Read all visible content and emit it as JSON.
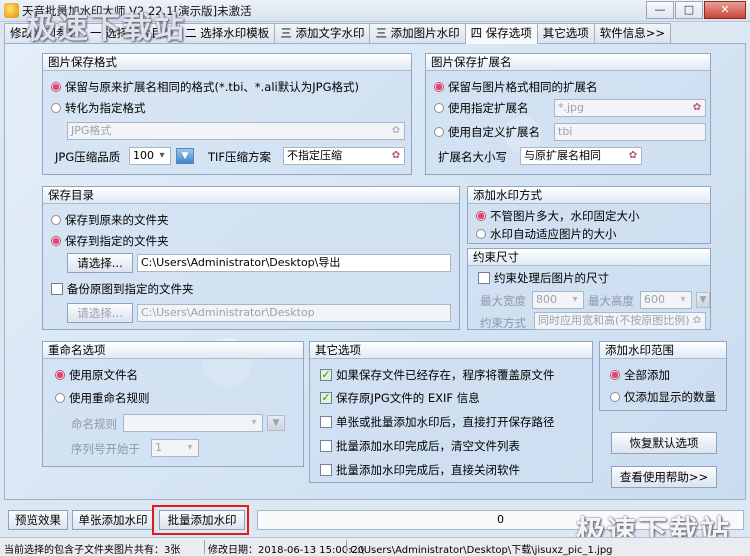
{
  "window": {
    "title": "天音批量加水印大师 V2.22.1[演示版]未激活",
    "controls": {
      "minimize": "—",
      "maximize": "□",
      "close": "✕"
    }
  },
  "watermark_text": "极速下载站",
  "tabs": [
    {
      "label": "修改水印参数"
    },
    {
      "label": "一 选择图片目录"
    },
    {
      "label": "二 选择水印模板"
    },
    {
      "label": "三 添加文字水印"
    },
    {
      "label": "三 添加图片水印"
    },
    {
      "label": "四 保存选项"
    },
    {
      "label": "其它选项"
    },
    {
      "label": "软件信息>>"
    }
  ],
  "image_format": {
    "title": "图片保存格式",
    "keep_original": "保留与原来扩展名相同的格式(*.tbi、*.ali默认为JPG格式)",
    "convert": "转化为指定格式",
    "format_value": "JPG格式",
    "jpg_quality_label": "JPG压缩品质",
    "jpg_quality_value": "100",
    "tif_label": "TIF压缩方案",
    "tif_value": "不指定压缩"
  },
  "extension": {
    "title": "图片保存扩展名",
    "keep_same": "保留与图片格式相同的扩展名",
    "use_specified": "使用指定扩展名",
    "specified_value": "*.jpg",
    "use_custom": "使用自定义扩展名",
    "custom_value": "tbi",
    "case_label": "扩展名大小写",
    "case_value": "与原扩展名相同"
  },
  "save_dir": {
    "title": "保存目录",
    "original_folder": "保存到原来的文件夹",
    "specified_folder": "保存到指定的文件夹",
    "browse_label": "请选择...",
    "path_value": "C:\\Users\\Administrator\\Desktop\\导出",
    "backup_label": "备份原图到指定的文件夹",
    "backup_browse_label": "请选择...",
    "backup_path": "C:\\Users\\Administrator\\Desktop"
  },
  "watermark_mode": {
    "title": "添加水印方式",
    "fixed": "不管图片多大，水印固定大小",
    "adaptive": "水印自动适应图片的大小"
  },
  "constraint": {
    "title": "约束尺寸",
    "enable_label": "约束处理后图片的尺寸",
    "max_width_label": "最大宽度",
    "max_width_value": "800",
    "max_height_label": "最大高度",
    "max_height_value": "600",
    "method_label": "约束方式",
    "method_value": "同时应用宽和高(不按原图比例)"
  },
  "rename": {
    "title": "重命名选项",
    "use_original": "使用原文件名",
    "use_rename_rule": "使用重命名规则",
    "rule_label": "命名规则",
    "seq_label": "序列号开始于",
    "seq_value": "1"
  },
  "other_options": {
    "title": "其它选项",
    "items": [
      {
        "label": "如果保存文件已经存在，程序将覆盖原文件",
        "checked": true
      },
      {
        "label": "保存原JPG文件的 EXIF 信息",
        "checked": true
      },
      {
        "label": "单张或批量添加水印后，直接打开保存路径",
        "checked": false
      },
      {
        "label": "批量添加水印完成后，清空文件列表",
        "checked": false
      },
      {
        "label": "批量添加水印完成后，直接关闭软件",
        "checked": false
      }
    ]
  },
  "range": {
    "title": "添加水印范围",
    "all": "全部添加",
    "only_visible": "仅添加显示的数量"
  },
  "side_buttons": {
    "restore_defaults": "恢复默认选项",
    "view_help": "查看使用帮助>>"
  },
  "bottom": {
    "preview": "预览效果",
    "single_add": "单张添加水印",
    "batch_add": "批量添加水印",
    "progress_value": "0"
  },
  "status": {
    "count_text": "当前选择的包含子文件夹图片共有：3张",
    "modified": "修改日期：2018-06-13 15:00:20",
    "file_path": "C:\\Users\\Administrator\\Desktop\\下载\\jisuxz_pic_1.jpg"
  },
  "colors": {
    "accent_pink": "#e0457a",
    "highlight_red": "#e11a1a",
    "panel_blue": "#d6e6f4"
  },
  "icons": {
    "dropdown": "butterfly-dropdown-icon",
    "spin": "down-triangle-icon"
  }
}
